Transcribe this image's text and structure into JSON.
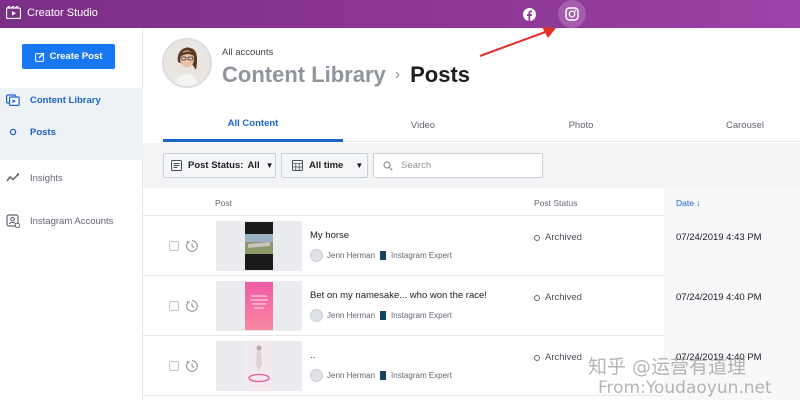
{
  "app": {
    "title": "Creator Studio"
  },
  "sidebar": {
    "create_label": "Create Post",
    "items": [
      {
        "label": "Content Library",
        "icon": "library-icon"
      },
      {
        "label": "Posts",
        "icon": "dot-icon"
      },
      {
        "label": "Insights",
        "icon": "insights-icon"
      },
      {
        "label": "Instagram Accounts",
        "icon": "accounts-icon"
      }
    ]
  },
  "header": {
    "account_label": "All accounts",
    "breadcrumb_root": "Content Library",
    "breadcrumb_separator": "›",
    "breadcrumb_current": "Posts"
  },
  "tabs": [
    "All Content",
    "Video",
    "Photo",
    "Carousel"
  ],
  "filters": {
    "status_label": "Post Status:",
    "status_value": "All",
    "time_label": "All time",
    "search_placeholder": "Search"
  },
  "table": {
    "columns": [
      "Post",
      "Post Status",
      "Date ↓"
    ],
    "rows": [
      {
        "title": "My horse",
        "author": "Jenn Herman",
        "author_suffix": "Instagram Expert",
        "status": "Archived",
        "date": "07/24/2019 4:43 PM"
      },
      {
        "title": "Bet on my namesake... who won the race!",
        "author": "Jenn Herman",
        "author_suffix": "Instagram Expert",
        "status": "Archived",
        "date": "07/24/2019 4:40 PM"
      },
      {
        "title": "..",
        "author": "Jenn Herman",
        "author_suffix": "Instagram Expert",
        "status": "Archived",
        "date": "07/24/2019 4:40 PM"
      }
    ]
  },
  "watermark": {
    "line1": "知乎 @运营有道理",
    "line2": "From:Youdaoyun.net"
  },
  "colors": {
    "topbar": "#8a3590",
    "accent": "#1a64c7",
    "button": "#1877f2",
    "arrow": "#e0312a"
  }
}
